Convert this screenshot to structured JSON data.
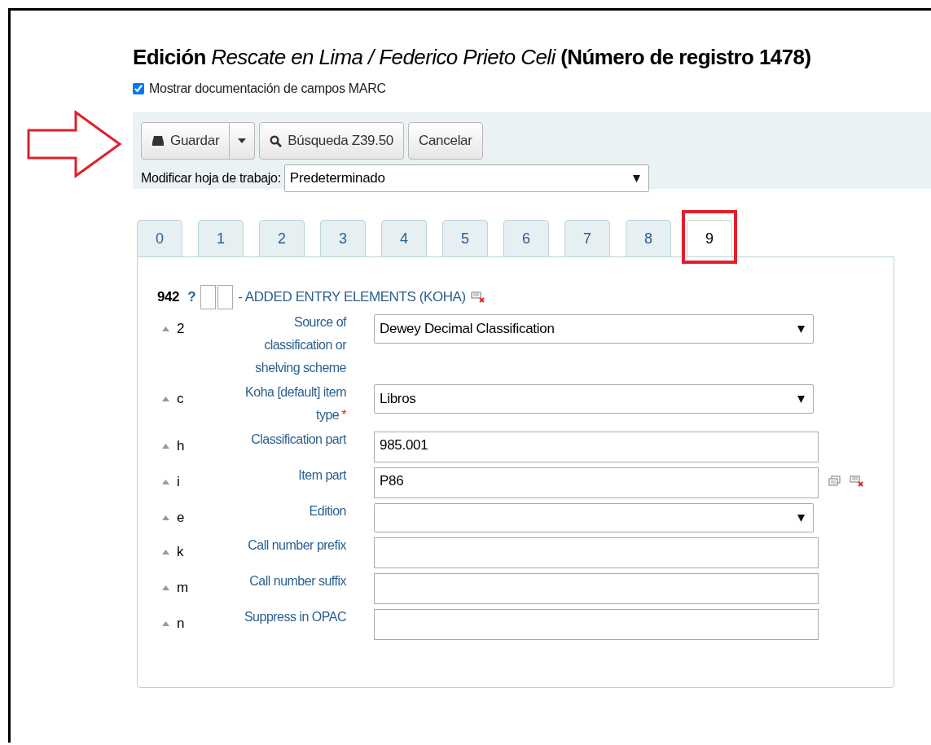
{
  "heading": {
    "prefix": "Edición",
    "title": "Rescate en Lima / Federico Prieto Celi",
    "record": "(Número de registro 1478)"
  },
  "show_docs": {
    "label": "Mostrar documentación de campos MARC",
    "checked": true
  },
  "toolbar": {
    "annotation_arrow": true,
    "save": "Guardar",
    "search": "Búsqueda Z39.50",
    "cancel": "Cancelar",
    "worksheet_label": "Modificar hoja de trabajo:",
    "worksheet_value": "Predeterminado"
  },
  "tabs": [
    {
      "label": "0",
      "selected": false,
      "annotated": false
    },
    {
      "label": "1",
      "selected": false,
      "annotated": false
    },
    {
      "label": "2",
      "selected": false,
      "annotated": false
    },
    {
      "label": "3",
      "selected": false,
      "annotated": false
    },
    {
      "label": "4",
      "selected": false,
      "annotated": false
    },
    {
      "label": "5",
      "selected": false,
      "annotated": false
    },
    {
      "label": "6",
      "selected": false,
      "annotated": false
    },
    {
      "label": "7",
      "selected": false,
      "annotated": false
    },
    {
      "label": "8",
      "selected": false,
      "annotated": false
    },
    {
      "label": "9",
      "selected": true,
      "annotated": true
    }
  ],
  "field": {
    "tag": "942",
    "help": "?",
    "title": "- ADDED ENTRY ELEMENTS (KOHA)"
  },
  "subfields": [
    {
      "code": "2",
      "label": "Source of classification or shelving scheme",
      "kind": "select",
      "value": "Dewey Decimal Classification",
      "tools": false
    },
    {
      "code": "c",
      "label": "Koha [default] item type",
      "required_mark": "*",
      "kind": "select",
      "value": "Libros",
      "tools": false
    },
    {
      "code": "h",
      "label": "Classification part",
      "kind": "input",
      "value": "985.001",
      "tools": false
    },
    {
      "code": "i",
      "label": "Item part",
      "kind": "input",
      "value": "P86",
      "tools": true
    },
    {
      "code": "e",
      "label": "Edition",
      "kind": "select",
      "tools": false
    },
    {
      "code": "k",
      "label": "Call number prefix",
      "kind": "input",
      "tools": false
    },
    {
      "code": "m",
      "label": "Call number suffix",
      "kind": "input",
      "tools": false
    },
    {
      "code": "n",
      "label": "Suppress in OPAC",
      "kind": "input",
      "tools": false
    }
  ]
}
